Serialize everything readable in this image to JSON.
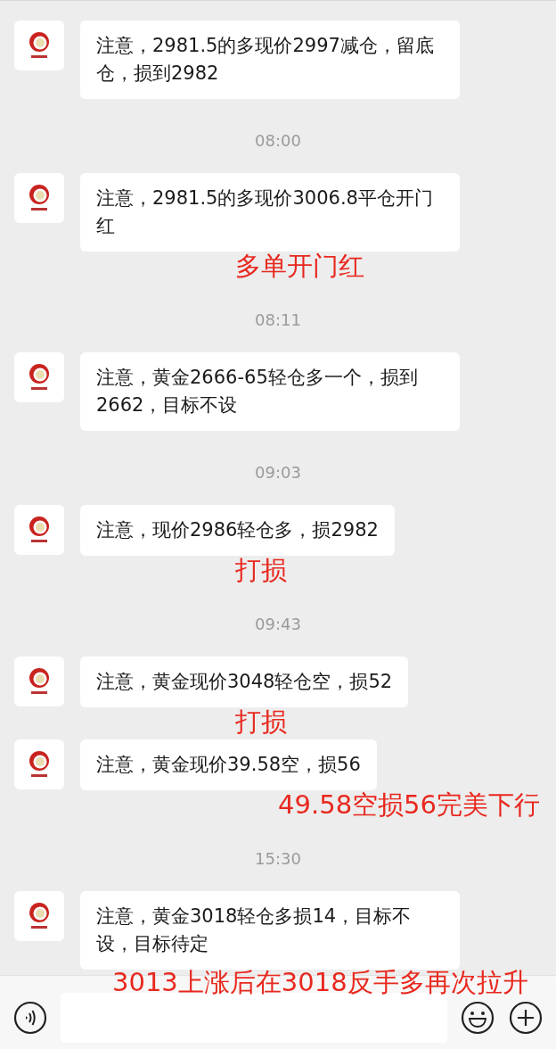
{
  "chat": [
    {
      "kind": "message",
      "text": "注意，2981.5的多现价2997减仓，留底仓，损到2982"
    },
    {
      "kind": "time",
      "text": "08:00"
    },
    {
      "kind": "message",
      "text": "注意，2981.5的多现价3006.8平仓开门红"
    },
    {
      "kind": "note",
      "text": "多单开门红"
    },
    {
      "kind": "time",
      "text": "08:11"
    },
    {
      "kind": "message",
      "text": "注意，黄金2666-65轻仓多一个，损到2662，目标不设"
    },
    {
      "kind": "time",
      "text": "09:03"
    },
    {
      "kind": "message",
      "text": "注意，现价2986轻仓多，损2982"
    },
    {
      "kind": "note",
      "text": "打损"
    },
    {
      "kind": "time",
      "text": "09:43"
    },
    {
      "kind": "message",
      "text": "注意，黄金现价3048轻仓空，损52"
    },
    {
      "kind": "note",
      "text": "打损"
    },
    {
      "kind": "message",
      "text": "注意，黄金现价39.58空，损56"
    },
    {
      "kind": "note_right",
      "text": "49.58空损56完美下行"
    },
    {
      "kind": "time",
      "text": "15:30"
    },
    {
      "kind": "message",
      "text": "注意，黄金3018轻仓多损14，目标不设，目标待定"
    }
  ],
  "input_bar": {
    "note": "3013上涨后在3018反手多再次拉升"
  }
}
